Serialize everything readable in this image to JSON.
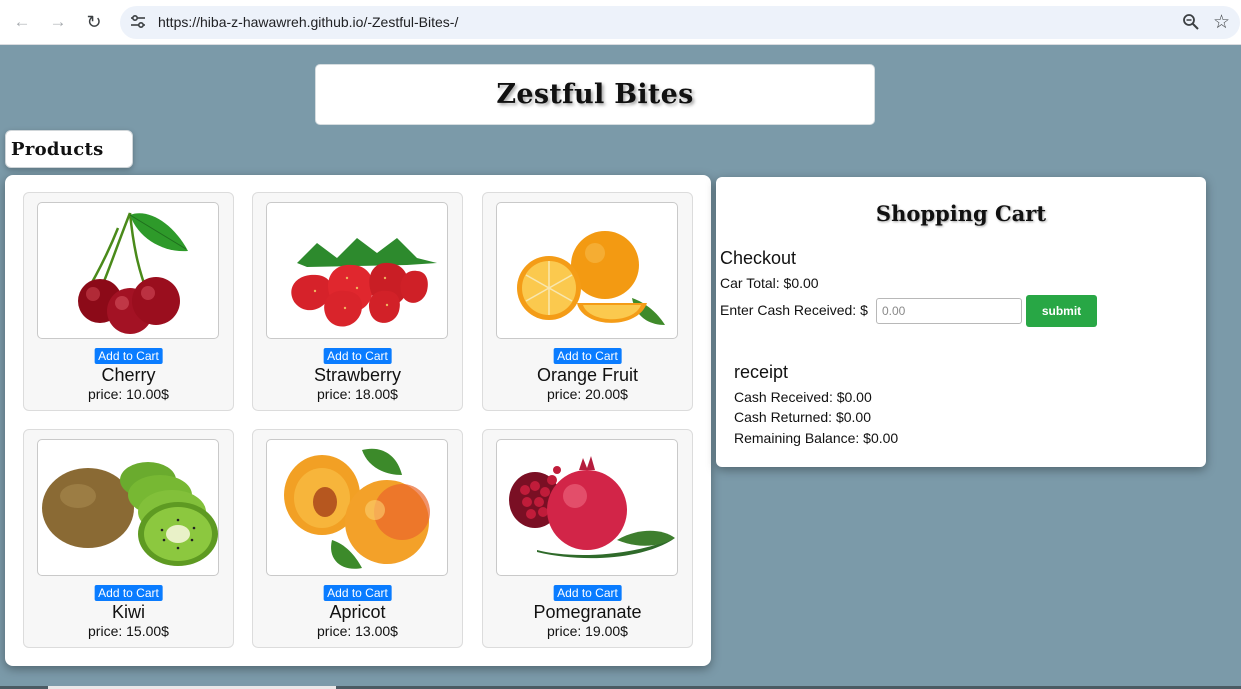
{
  "browser": {
    "url": "https://hiba-z-hawawreh.github.io/-Zestful-Bites-/"
  },
  "header": {
    "title": "Zestful Bites"
  },
  "products_label": "Products",
  "products": [
    {
      "name": "Cherry",
      "price": "price: 10.00$",
      "button": "Add to Cart"
    },
    {
      "name": "Strawberry",
      "price": "price: 18.00$",
      "button": "Add to Cart"
    },
    {
      "name": "Orange Fruit",
      "price": "price: 20.00$",
      "button": "Add to Cart"
    },
    {
      "name": "Kiwi",
      "price": "price: 15.00$",
      "button": "Add to Cart"
    },
    {
      "name": "Apricot",
      "price": "price: 13.00$",
      "button": "Add to Cart"
    },
    {
      "name": "Pomegranate",
      "price": "price: 19.00$",
      "button": "Add to Cart"
    }
  ],
  "cart": {
    "title": "Shopping Cart",
    "checkout_heading": "Checkout",
    "car_total": "Car Total: $0.00",
    "cash_label": "Enter Cash Received: $",
    "cash_placeholder": "0.00",
    "submit_label": "submit",
    "receipt_heading": "receipt",
    "cash_received": "Cash Received: $0.00",
    "cash_returned": "Cash Returned: $0.00",
    "remaining_balance": "Remaining Balance: $0.00"
  },
  "colors": {
    "page_background": "#7b9aa9",
    "add_to_cart": "#0a7cff",
    "submit": "#28a745"
  }
}
